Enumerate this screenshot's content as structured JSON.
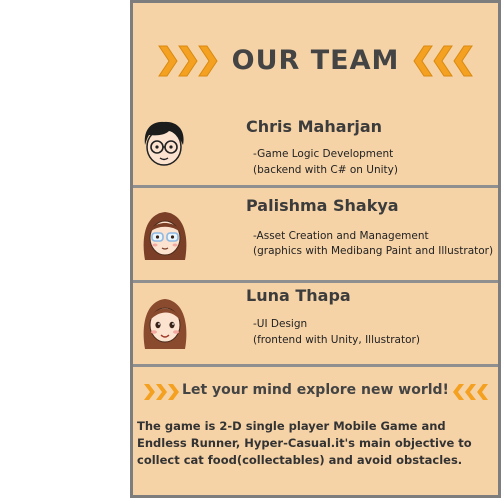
{
  "header": {
    "title": "OUR TEAM",
    "arrow_color": "#f4a020"
  },
  "members": [
    {
      "name": "Chris Maharjan",
      "role_line1": "-Game Logic Development",
      "role_line2": "(backend with C# on Unity)",
      "avatar": "boy-glasses-avatar-icon"
    },
    {
      "name": "Palishma Shakya",
      "role_line1": "-Asset Creation and Management",
      "role_line2": "(graphics with Medibang Paint and Illustrator)",
      "avatar": "girl-glasses-avatar-icon"
    },
    {
      "name": "Luna Thapa",
      "role_line1": "-UI Design",
      "role_line2": "(frontend with Unity, Illustrator)",
      "avatar": "girl-avatar-icon"
    }
  ],
  "tagline": "Let your mind explore new world!",
  "description": "The  game is 2-D single player Mobile Game and Endless Runner, Hyper-Casual.it's main objective to collect cat food(collectables) and avoid obstacles.",
  "colors": {
    "background": "#f6d3a7",
    "border": "#7d7d7d"
  }
}
